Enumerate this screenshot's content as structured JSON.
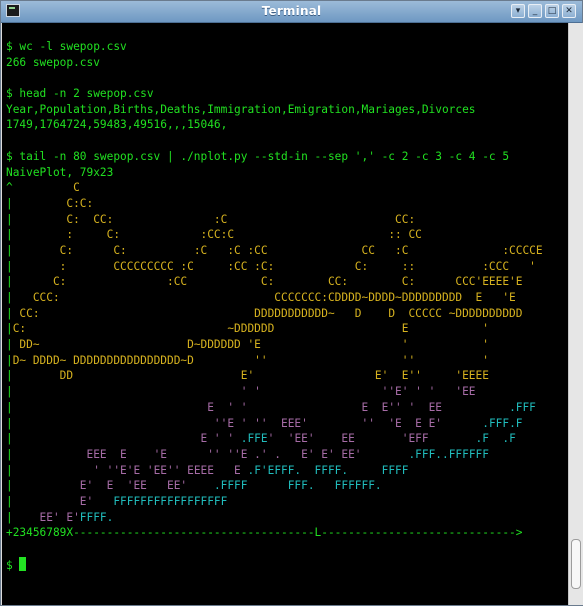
{
  "window": {
    "title": "Terminal"
  },
  "titlebar_buttons": [
    "arrow-icon",
    "minimize-icon",
    "maximize-icon",
    "close-icon"
  ],
  "colors": {
    "prompt": "#21e021",
    "plot_yellow": "#d6b21f",
    "plot_purple": "#a66ca6",
    "plot_cyan": "#21bcbc",
    "background": "#000000"
  },
  "terminal": {
    "lines": [
      {
        "segs": [
          {
            "t": "$ wc -l swepop.csv",
            "c": "g"
          }
        ]
      },
      {
        "segs": [
          {
            "t": "266 swepop.csv",
            "c": "g"
          }
        ]
      },
      {
        "segs": [
          {
            "t": "",
            "c": "g"
          }
        ]
      },
      {
        "segs": [
          {
            "t": "$ head -n 2 swepop.csv",
            "c": "g"
          }
        ]
      },
      {
        "segs": [
          {
            "t": "Year,Population,Births,Deaths,Immigration,Emigration,Mariages,Divorces",
            "c": "g"
          }
        ]
      },
      {
        "segs": [
          {
            "t": "1749,1764724,59483,49516,,,15046,",
            "c": "g"
          }
        ]
      },
      {
        "segs": [
          {
            "t": "",
            "c": "g"
          }
        ]
      },
      {
        "segs": [
          {
            "t": "$ tail -n 80 swepop.csv | ./nplot.py --std-in --sep ',' -c 2 -c 3 -c 4 -c 5",
            "c": "g"
          }
        ]
      },
      {
        "segs": [
          {
            "t": "NaivePlot, 79x23",
            "c": "g"
          }
        ]
      },
      {
        "segs": [
          {
            "t": "^",
            "c": "g"
          },
          {
            "t": "         C",
            "c": "y"
          }
        ]
      },
      {
        "segs": [
          {
            "t": "|",
            "c": "g"
          },
          {
            "t": "        C:C:",
            "c": "y"
          }
        ]
      },
      {
        "segs": [
          {
            "t": "|",
            "c": "g"
          },
          {
            "t": "        C:  CC:               :C                         CC:",
            "c": "y"
          }
        ]
      },
      {
        "segs": [
          {
            "t": "|",
            "c": "g"
          },
          {
            "t": "        :     C:            :CC:C                       :: CC",
            "c": "y"
          }
        ]
      },
      {
        "segs": [
          {
            "t": "|",
            "c": "g"
          },
          {
            "t": "       C:      C:          :C   :C :CC              CC   :C              :CCCCE",
            "c": "y"
          }
        ]
      },
      {
        "segs": [
          {
            "t": "|",
            "c": "g"
          },
          {
            "t": "       :       CCCCCCCCC :C     :CC :C:            C:     ::          :CCC   '",
            "c": "y"
          }
        ]
      },
      {
        "segs": [
          {
            "t": "|",
            "c": "g"
          },
          {
            "t": "      C:               :CC           C:        CC:        C:      CCC'EEEE'E",
            "c": "y"
          }
        ]
      },
      {
        "segs": [
          {
            "t": "|",
            "c": "g"
          },
          {
            "t": "   CCC:                                CCCCCCC:CDDDD~DDDD~DDDDDDDDD  E   'E",
            "c": "y"
          }
        ]
      },
      {
        "segs": [
          {
            "t": "|",
            "c": "g"
          },
          {
            "t": " CC:                                DDDDDDDDDDD~   D    D  CCCCC ~DDDDDDDDDD",
            "c": "y"
          }
        ]
      },
      {
        "segs": [
          {
            "t": "|",
            "c": "g"
          },
          {
            "t": "C:                              ~DDDDDD                   E           '",
            "c": "y"
          }
        ]
      },
      {
        "segs": [
          {
            "t": "|",
            "c": "g"
          },
          {
            "t": " DD~                      D~DDDDDD 'E                     '           '",
            "c": "y"
          }
        ]
      },
      {
        "segs": [
          {
            "t": "|",
            "c": "g"
          },
          {
            "t": "D~ DDDD~ DDDDDDDDDDDDDDDD~D         ''                    ''          '",
            "c": "y"
          }
        ]
      },
      {
        "segs": [
          {
            "t": "|",
            "c": "g"
          },
          {
            "t": "       DD                         E'                  E'  E''     'EEEE",
            "c": "y"
          }
        ]
      },
      {
        "segs": [
          {
            "t": "|",
            "c": "g"
          },
          {
            "t": "                                  ' '                  ''E' ' '   'EE",
            "c": "p"
          }
        ]
      },
      {
        "segs": [
          {
            "t": "|",
            "c": "g"
          },
          {
            "t": "                             E  ' '                 E  E'' '  EE          ",
            "c": "p"
          },
          {
            "t": ".FFF",
            "c": "c"
          }
        ]
      },
      {
        "segs": [
          {
            "t": "|",
            "c": "g"
          },
          {
            "t": "                              ''E ' ''  EEE'        ''  'E  E E'      ",
            "c": "p"
          },
          {
            "t": ".FFF.F",
            "c": "c"
          }
        ]
      },
      {
        "segs": [
          {
            "t": "|",
            "c": "g"
          },
          {
            "t": "                            E ' ' ",
            "c": "p"
          },
          {
            "t": ".FFE",
            "c": "c"
          },
          {
            "t": "'  'EE'    EE       'EFF       ",
            "c": "p"
          },
          {
            "t": ".F  .F",
            "c": "c"
          }
        ]
      },
      {
        "segs": [
          {
            "t": "|",
            "c": "g"
          },
          {
            "t": "           EEE  E    'E      '' ''E .' .   E' E' EE'       ",
            "c": "p"
          },
          {
            "t": ".FFF..FFFFFF",
            "c": "c"
          }
        ]
      },
      {
        "segs": [
          {
            "t": "|",
            "c": "g"
          },
          {
            "t": "            ' ''E'E 'EE'' EEEE   E ",
            "c": "p"
          },
          {
            "t": ".F'EFFF.  FFFF.     FFFF",
            "c": "c"
          }
        ]
      },
      {
        "segs": [
          {
            "t": "|",
            "c": "g"
          },
          {
            "t": "          E'  E  'EE   EE'    ",
            "c": "p"
          },
          {
            "t": ".FFFF      FFF.   FFFFFF.",
            "c": "c"
          }
        ]
      },
      {
        "segs": [
          {
            "t": "|",
            "c": "g"
          },
          {
            "t": "          E'   ",
            "c": "p"
          },
          {
            "t": "FFFFFFFFFFFFFFFFF",
            "c": "c"
          }
        ]
      },
      {
        "segs": [
          {
            "t": "|",
            "c": "g"
          },
          {
            "t": "    EE' E'",
            "c": "p"
          },
          {
            "t": "FFFF.",
            "c": "c"
          }
        ]
      },
      {
        "segs": [
          {
            "t": "+23456789X------------------------------------L-----------------------------> ",
            "c": "g"
          }
        ]
      },
      {
        "segs": [
          {
            "t": "",
            "c": "g"
          }
        ]
      },
      {
        "segs": [
          {
            "t": "$ ",
            "c": "g"
          }
        ],
        "cursor": true
      }
    ]
  }
}
